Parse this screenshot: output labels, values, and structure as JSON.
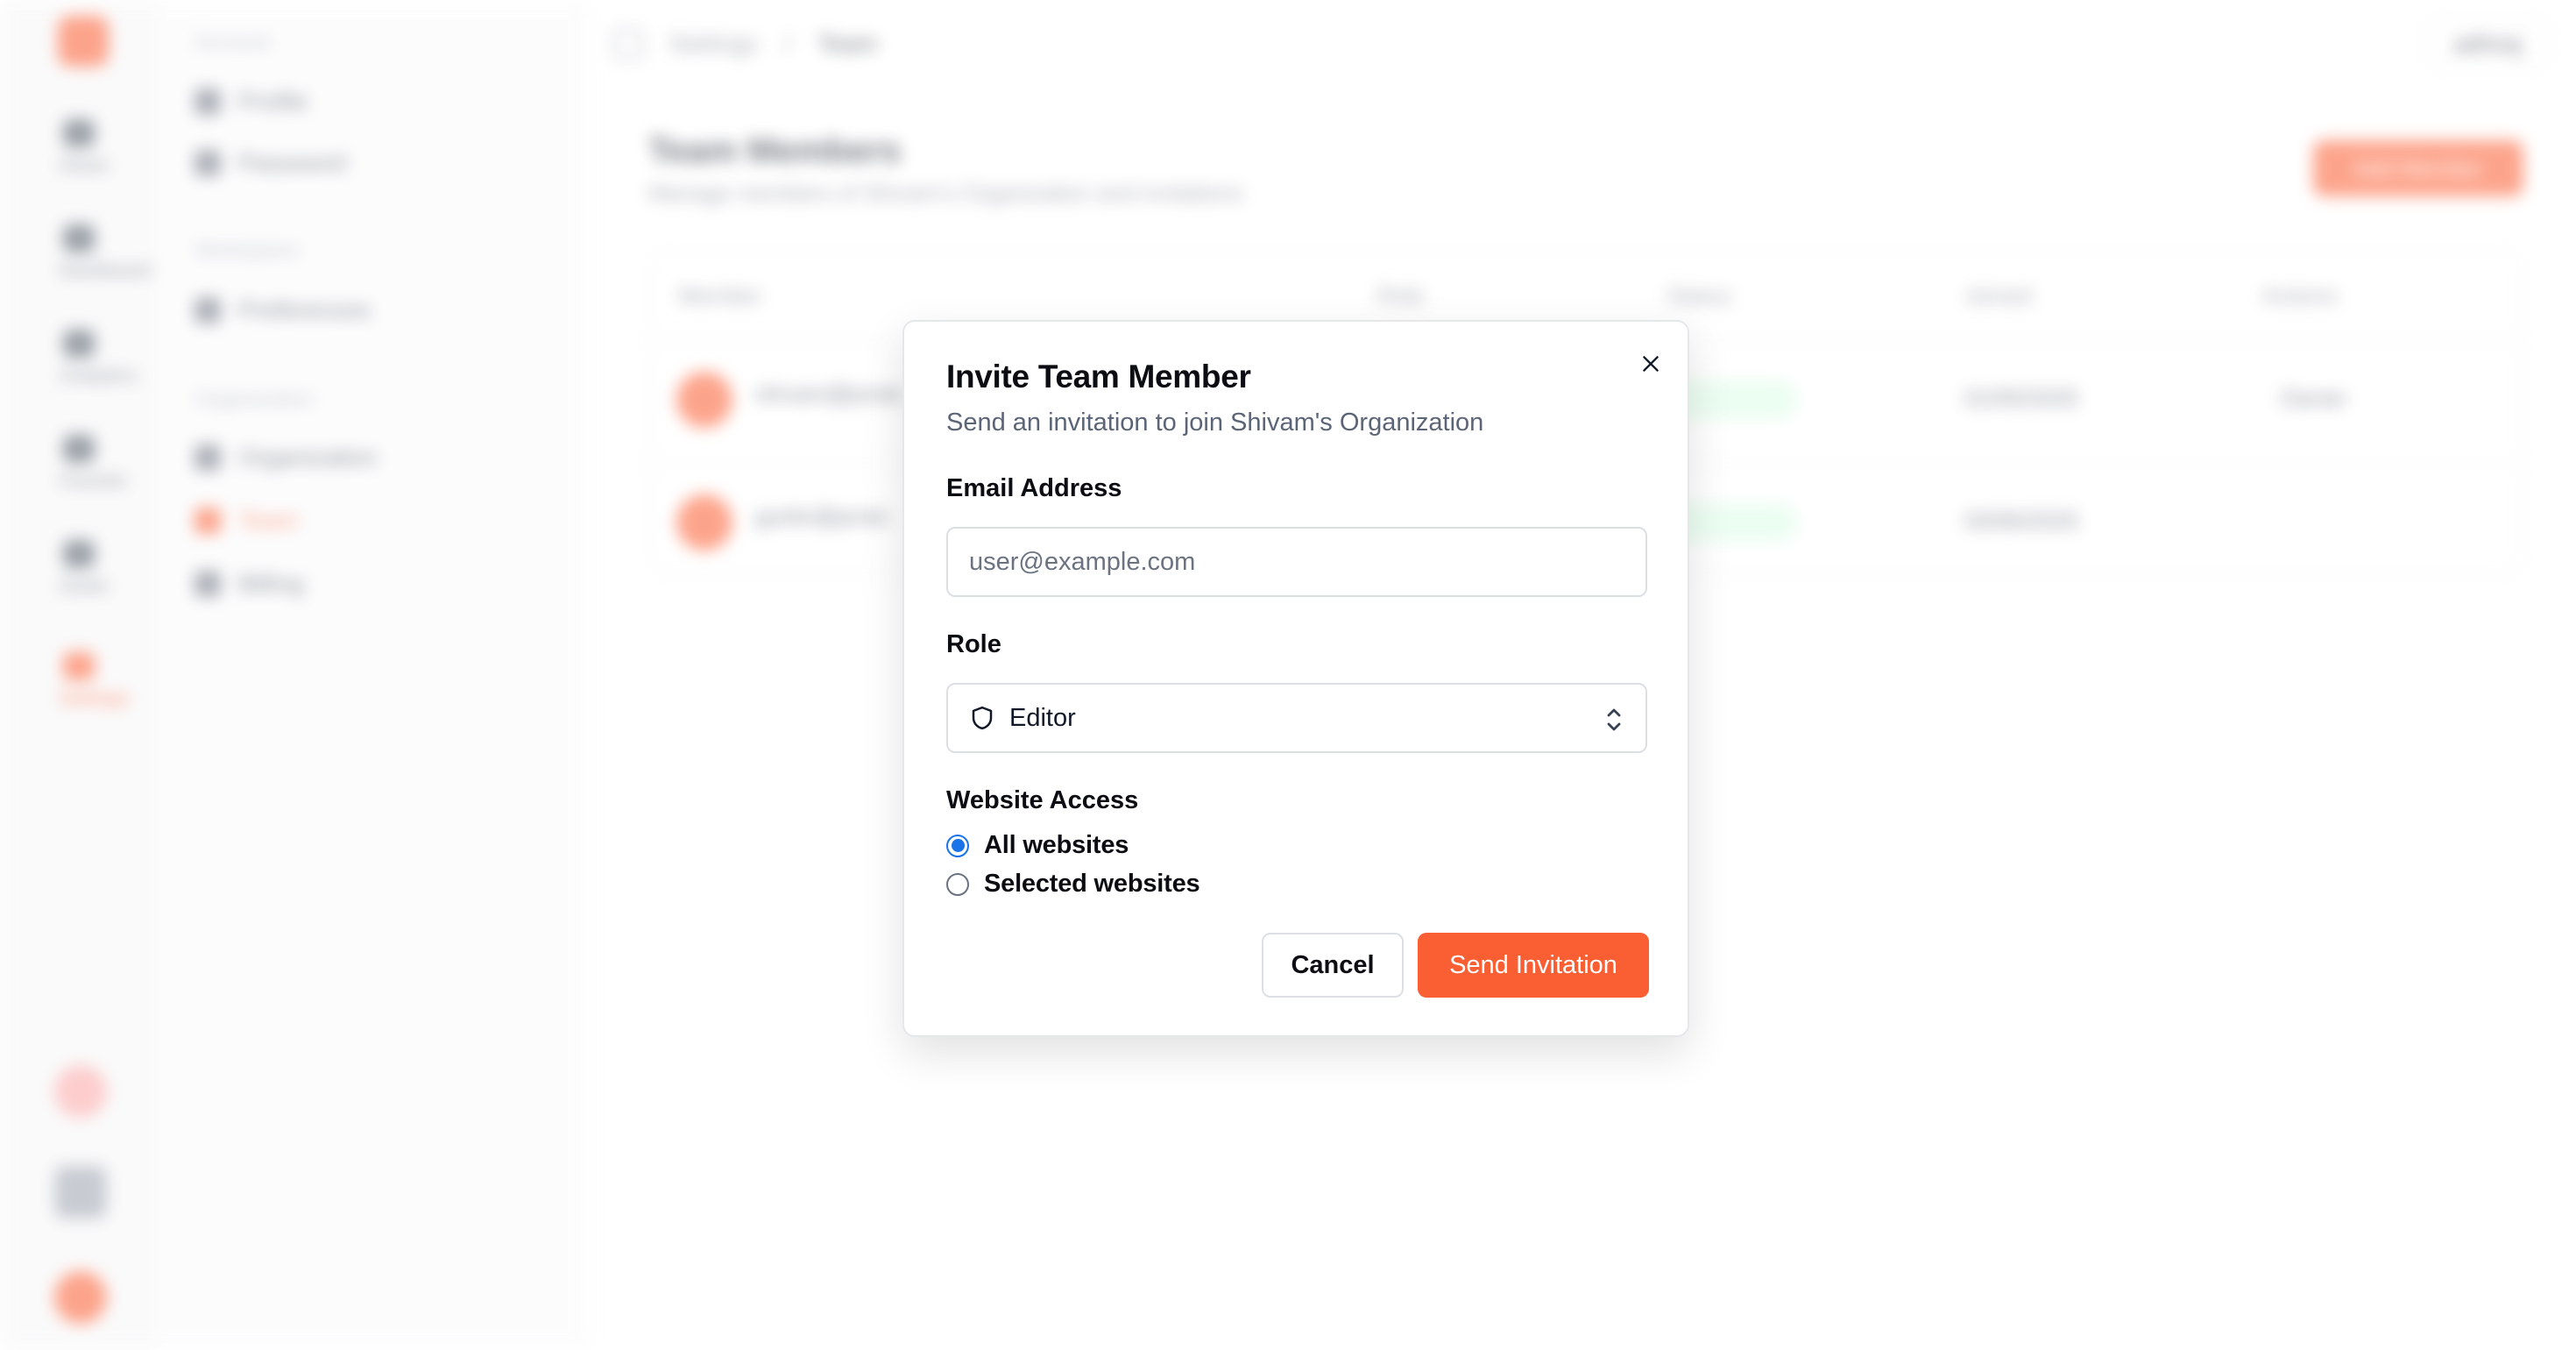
{
  "background": {
    "rail": {
      "items": [
        {
          "label": "Home"
        },
        {
          "label": "Dashboard"
        },
        {
          "label": "Analytics"
        },
        {
          "label": "Funnels"
        },
        {
          "label": "Goals"
        },
        {
          "label": "Settings"
        }
      ]
    },
    "subnav": {
      "sections": [
        {
          "title": "Account",
          "items": [
            "Profile",
            "Password"
          ]
        },
        {
          "title": "Workspace",
          "items": [
            "Preferences"
          ]
        },
        {
          "title": "Organization",
          "items": [
            "Organization",
            "Team",
            "Billing"
          ]
        }
      ]
    },
    "breadcrumb": [
      "Settings",
      "Team"
    ],
    "user_chip": "adhiraj",
    "page_title": "Team Members",
    "page_subtitle": "Manage members of Shivam's Organization and invitations",
    "add_button": "Add Member",
    "table": {
      "headers": [
        "Member",
        "Role",
        "Status",
        "Joined",
        "Actions"
      ],
      "rows": [
        {
          "member": "shivam@proto",
          "status": "Active",
          "joined": "01/05/2025",
          "action": "Owner"
        },
        {
          "member": "gurbir@proto",
          "status": "Active",
          "joined": "03/06/2025",
          "action": ""
        }
      ]
    }
  },
  "modal": {
    "title": "Invite Team Member",
    "description": "Send an invitation to join Shivam's Organization",
    "email": {
      "label": "Email Address",
      "value": "",
      "placeholder": "user@example.com"
    },
    "role": {
      "label": "Role",
      "selected": "Editor",
      "icon": "shield-icon"
    },
    "website_access": {
      "label": "Website Access",
      "options": [
        {
          "label": "All websites",
          "checked": true
        },
        {
          "label": "Selected websites",
          "checked": false
        }
      ]
    },
    "cancel_label": "Cancel",
    "send_label": "Send Invitation"
  },
  "colors": {
    "accent": "#fa5f34",
    "radio": "#1a73e8"
  }
}
